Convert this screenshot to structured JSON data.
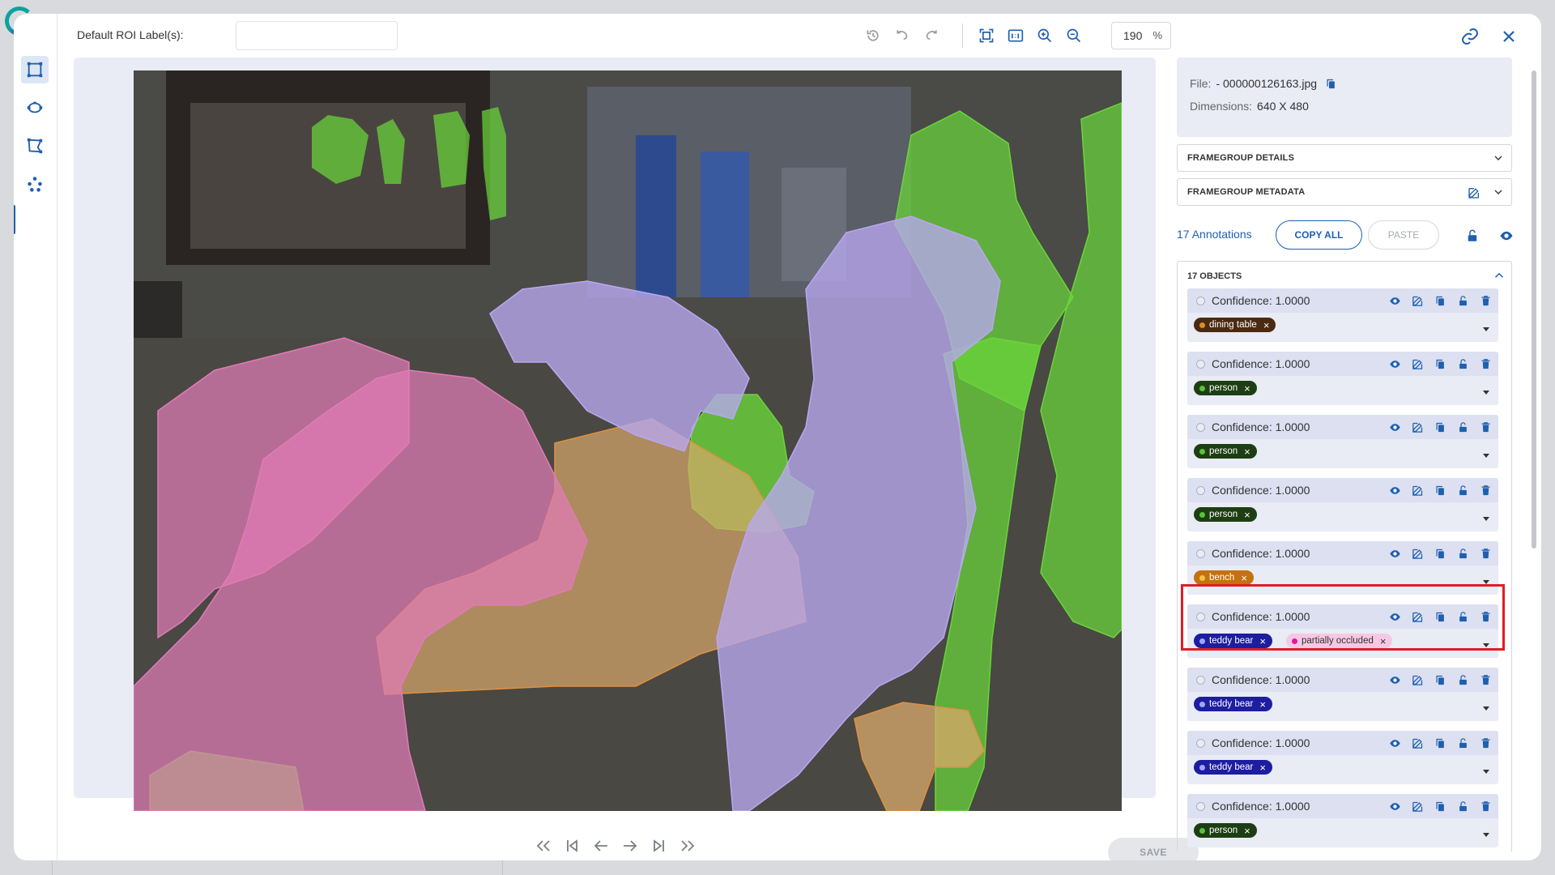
{
  "toolbar": {
    "roi_label": "Default ROI Label(s):",
    "roi_value": "",
    "zoom_value": "190",
    "zoom_unit": "%"
  },
  "rail": {
    "tools": [
      "bounding-box-tool",
      "ellipse-tool",
      "polygon-tool",
      "keypoints-tool"
    ]
  },
  "file": {
    "file_label": "File:",
    "file_name": "- 000000126163.jpg",
    "dimensions_label": "Dimensions:",
    "dimensions_value": "640 X 480"
  },
  "sections": {
    "framegroup_details": "FRAMEGROUP DETAILS",
    "framegroup_metadata": "FRAMEGROUP METADATA"
  },
  "annotations": {
    "count_label": "17 Annotations",
    "copy_all": "COPY ALL",
    "paste": "PASTE",
    "objects_header": "17 OBJECTS"
  },
  "objects": [
    {
      "confidence": "Confidence: 1.0000",
      "tags": [
        {
          "label": "dining table",
          "color": "#4a2a10",
          "dot": "#e08a20"
        }
      ]
    },
    {
      "confidence": "Confidence: 1.0000",
      "tags": [
        {
          "label": "person",
          "color": "#1d3e13",
          "dot": "#57c23a"
        }
      ]
    },
    {
      "confidence": "Confidence: 1.0000",
      "tags": [
        {
          "label": "person",
          "color": "#1d3e13",
          "dot": "#57c23a"
        }
      ]
    },
    {
      "confidence": "Confidence: 1.0000",
      "tags": [
        {
          "label": "person",
          "color": "#1d3e13",
          "dot": "#57c23a"
        }
      ]
    },
    {
      "confidence": "Confidence: 1.0000",
      "tags": [
        {
          "label": "bench",
          "color": "#c4720f",
          "dot": "#f3c14a"
        }
      ]
    },
    {
      "confidence": "Confidence: 1.0000",
      "tags": [
        {
          "label": "teddy bear",
          "color": "#1d1da0",
          "dot": "#9fa6ff"
        },
        {
          "label": "partially occluded",
          "color": "#f6c8e4",
          "dot": "#e2199b",
          "dark": true
        }
      ]
    },
    {
      "confidence": "Confidence: 1.0000",
      "tags": [
        {
          "label": "teddy bear",
          "color": "#1d1da0",
          "dot": "#9fa6ff"
        }
      ]
    },
    {
      "confidence": "Confidence: 1.0000",
      "tags": [
        {
          "label": "teddy bear",
          "color": "#1d1da0",
          "dot": "#9fa6ff"
        }
      ]
    },
    {
      "confidence": "Confidence: 1.0000",
      "tags": [
        {
          "label": "person",
          "color": "#1d3e13",
          "dot": "#57c23a"
        }
      ]
    }
  ],
  "footer": {
    "save": "SAVE"
  },
  "colors": {
    "accent": "#1f5fae",
    "highlight": "#e01c26",
    "teddy_mask": "#b8a8f0",
    "pink_mask": "#e07bb6",
    "person_mask": "#6ad63a",
    "table_mask": "#d9a86a"
  }
}
